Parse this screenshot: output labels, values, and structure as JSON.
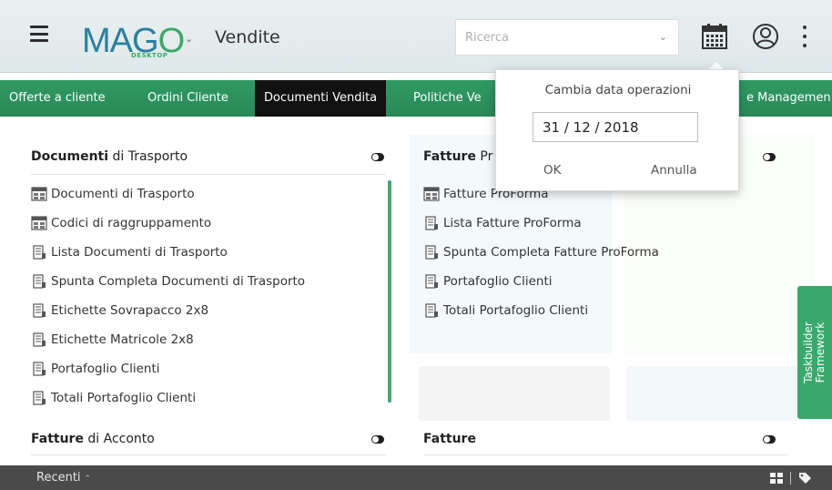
{
  "header": {
    "logo_main": "MAGO",
    "logo_sub": "DESKTOP",
    "module_title": "Vendite",
    "search_placeholder": "Ricerca",
    "icons": [
      "hamburger-menu-icon",
      "chevron-down-icon",
      "calendar-icon",
      "user-icon",
      "more-vertical-icon"
    ]
  },
  "tabs": [
    {
      "label": "Offerte a cliente",
      "active": false
    },
    {
      "label": "Ordini Cliente",
      "active": false
    },
    {
      "label": "Documenti Vendita",
      "active": true
    },
    {
      "label": "Politiche Ve",
      "active": false
    },
    {
      "label": "e Managemen",
      "active": false
    }
  ],
  "sections": {
    "trasporto": {
      "title_bold": "Documenti",
      "title_rest": " di Trasporto",
      "items": [
        {
          "label": "Documenti di Trasporto",
          "icon": "document-form-icon"
        },
        {
          "label": "Codici di raggruppamento",
          "icon": "document-form-icon"
        },
        {
          "label": "Lista Documenti di Trasporto",
          "icon": "report-icon"
        },
        {
          "label": "Spunta Completa Documenti di Trasporto",
          "icon": "report-icon"
        },
        {
          "label": "Etichette Sovrapacco 2x8",
          "icon": "report-icon"
        },
        {
          "label": "Etichette Matricole 2x8",
          "icon": "report-icon"
        },
        {
          "label": "Portafoglio Clienti",
          "icon": "report-icon"
        },
        {
          "label": "Totali Portafoglio Clienti",
          "icon": "report-icon"
        }
      ]
    },
    "proforma": {
      "title_bold": "Fatture",
      "title_rest": " Pr",
      "items": [
        {
          "label": "Fatture ProForma",
          "icon": "document-form-icon"
        },
        {
          "label": "Lista Fatture ProForma",
          "icon": "report-icon"
        },
        {
          "label": "Spunta Completa Fatture ProForma",
          "icon": "report-icon"
        },
        {
          "label": "Portafoglio Clienti",
          "icon": "report-icon"
        },
        {
          "label": "Totali Portafoglio Clienti",
          "icon": "report-icon"
        }
      ]
    },
    "acconto": {
      "title_bold": "Fatture",
      "title_rest": " di Acconto"
    },
    "fatture": {
      "title_bold": "Fatture",
      "title_rest": ""
    }
  },
  "popup": {
    "title": "Cambia data operazioni",
    "date_value": "31 / 12 / 2018",
    "ok_label": "OK",
    "cancel_label": "Annulla"
  },
  "sidetab": {
    "line1": "Taskbuilder",
    "line2": "Framework"
  },
  "footer": {
    "recent_label": "Recenti",
    "icons": [
      "chevron-up-icon",
      "grid-icon",
      "tags-icon"
    ]
  },
  "colors": {
    "accent_green": "#2f9a63",
    "active_tab": "#111111",
    "footer": "#4a4a4a",
    "logo_blue": "#2b7fa0",
    "logo_green": "#3ca86a"
  }
}
